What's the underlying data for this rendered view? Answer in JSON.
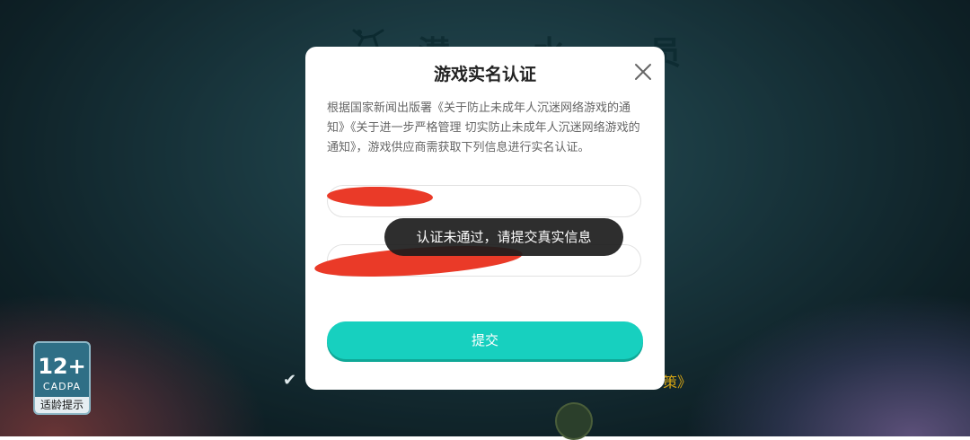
{
  "background": {
    "game_title": "潜 水 员",
    "agreement_check": "✔",
    "agreement_link_fragment": "策》"
  },
  "age_rating": {
    "age": "12+",
    "org": "CADPA",
    "tip": "适龄提示"
  },
  "dialog": {
    "title": "游戏实名认证",
    "notice": "根据国家新闻出版署《关于防止未成年人沉迷网络游戏的通知》《关于进一步严格管理 切实防止未成年人沉迷网络游戏的通知》，游戏供应商需获取下列信息进行实名认证。",
    "name_field": {
      "value": "",
      "placeholder": ""
    },
    "id_field": {
      "value": "",
      "placeholder": ""
    },
    "submit_label": "提交",
    "close_icon": "close-icon"
  },
  "toast": {
    "message": "认证未通过，请提交真实信息"
  },
  "colors": {
    "accent": "#17d0bf",
    "redaction": "#ea3a28",
    "toast_bg": "#1c1c1c"
  }
}
